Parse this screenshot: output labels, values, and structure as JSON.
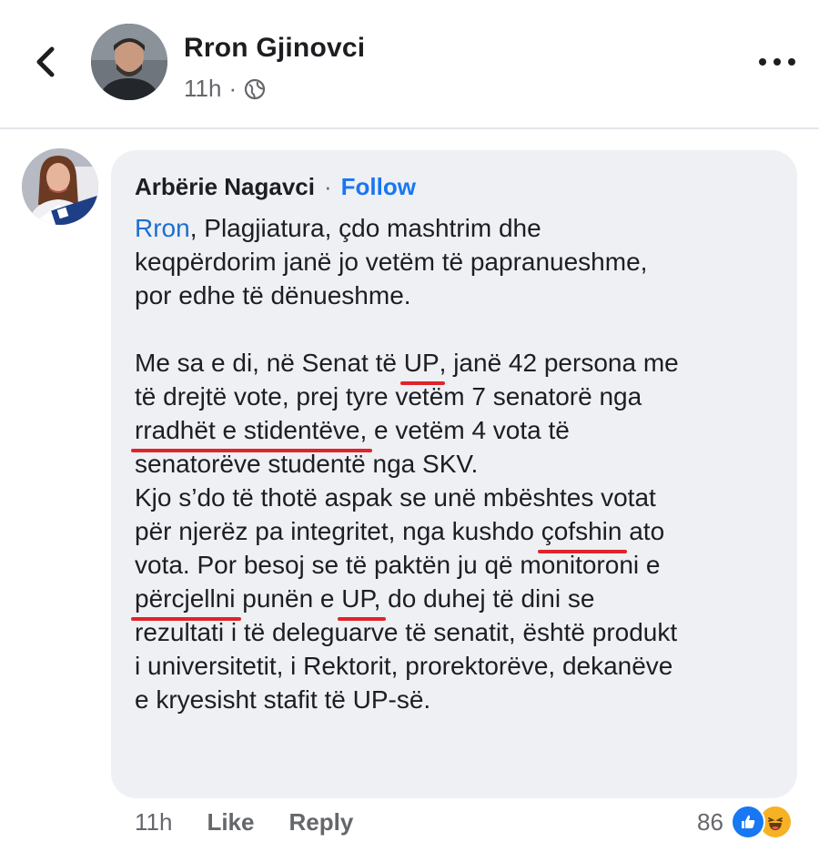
{
  "header": {
    "author": "Rron Gjinovci",
    "time": "11h",
    "separator": "·"
  },
  "comment": {
    "name": "Arbërie Nagavci",
    "separator": "·",
    "follow": "Follow",
    "mention": "Rron",
    "lines": [
      ",  Plagjiatura, çdo mashtrim dhe",
      "keqpërdorim janë jo vetëm të papranueshme,",
      "por edhe të dënueshme.",
      "",
      "Me sa e di,  në Senat të ",
      "UP",
      ", janë 42 persona me",
      "të drejtë vote, prej tyre vetëm 7 senatorë nga",
      "rradhët e stidentëve,",
      " e vetëm 4 vota të",
      "senatorëve studentë nga SKV.",
      " Kjo s’do të thotë aspak se unë mbështes votat",
      "për njerëz pa integritet, nga kushdo ",
      "çofshin",
      " ato",
      "vota. Por besoj se të paktën ju që monitoroni e",
      "përcjellni",
      " punën e ",
      "UP,",
      " do duhej të dini se",
      "rezultati i të deleguarve të senatit, është produkt",
      "i universitetit, i Rektorit, prorektorëve, dekanëve",
      "e kryesisht stafit të UP-së."
    ],
    "time": "11h",
    "like": "Like",
    "reply": "Reply",
    "reaction_count": "86"
  },
  "colors": {
    "link": "#1877f2",
    "underline": "#e0242b",
    "bubble": "#eef0f4",
    "muted": "#65676b"
  },
  "icons": [
    "back-chevron-icon",
    "globe-icon",
    "more-dots-icon",
    "like-reaction-icon",
    "haha-reaction-icon"
  ]
}
